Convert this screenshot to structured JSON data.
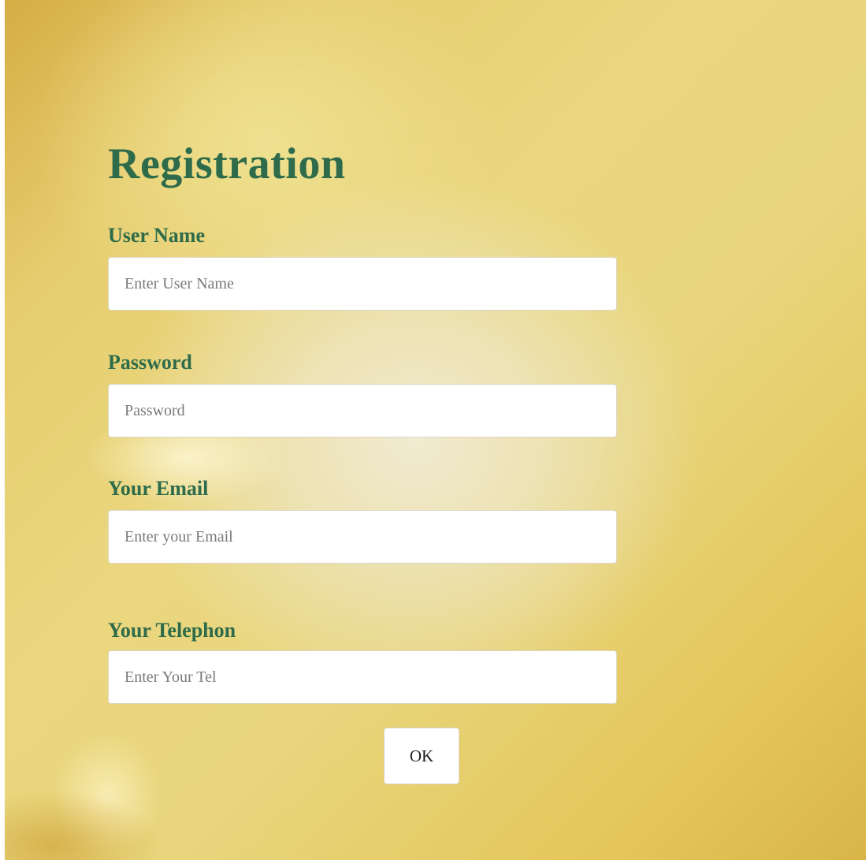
{
  "form": {
    "title": "Registration",
    "fields": [
      {
        "label": "User Name",
        "placeholder": "Enter User Name"
      },
      {
        "label": "Password",
        "placeholder": "Password"
      },
      {
        "label": "Your Email",
        "placeholder": "Enter your Email"
      },
      {
        "label": "Your Telephon",
        "placeholder": "Enter Your Tel"
      }
    ],
    "submit_label": "OK"
  },
  "colors": {
    "heading": "#2e6b4a",
    "background_gold": "#e6cc6e",
    "field_background": "#ffffff"
  }
}
